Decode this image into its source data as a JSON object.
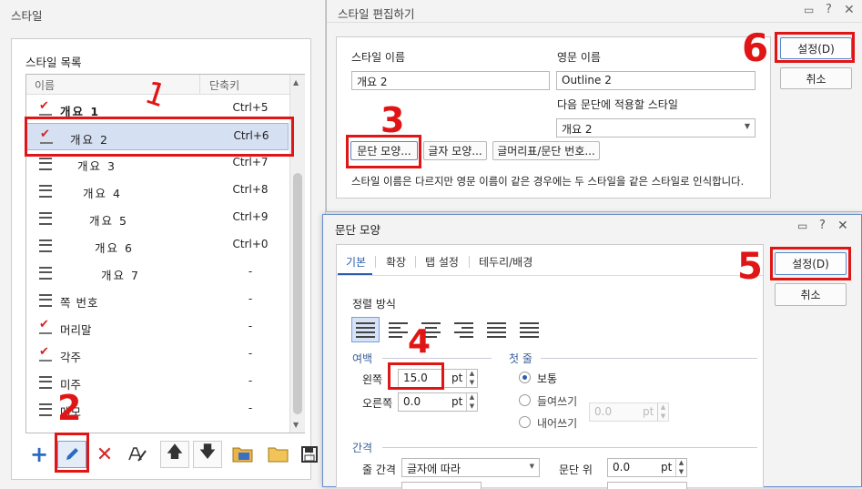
{
  "style_panel": {
    "title": "스타일",
    "list_label": "스타일 목록",
    "col_name": "이름",
    "col_shortcut": "단축키",
    "items": [
      {
        "name": "개요 1",
        "shortcut": "Ctrl+5",
        "icon": "checked-style-icon"
      },
      {
        "name": "개요 2",
        "shortcut": "Ctrl+6",
        "icon": "checked-style-icon"
      },
      {
        "name": "개요 3",
        "shortcut": "Ctrl+7",
        "icon": "paragraph-style-icon"
      },
      {
        "name": "개요 4",
        "shortcut": "Ctrl+8",
        "icon": "paragraph-style-icon"
      },
      {
        "name": "개요 5",
        "shortcut": "Ctrl+9",
        "icon": "paragraph-style-icon"
      },
      {
        "name": "개요 6",
        "shortcut": "Ctrl+0",
        "icon": "paragraph-style-icon"
      },
      {
        "name": "개요 7",
        "shortcut": "-",
        "icon": "paragraph-style-icon"
      },
      {
        "name": "쪽 번호",
        "shortcut": "-",
        "icon": "paragraph-style-icon"
      },
      {
        "name": "머리말",
        "shortcut": "-",
        "icon": "checked-style-icon"
      },
      {
        "name": "각주",
        "shortcut": "-",
        "icon": "checked-style-icon"
      },
      {
        "name": "미주",
        "shortcut": "-",
        "icon": "paragraph-style-icon"
      },
      {
        "name": "메모",
        "shortcut": "-",
        "icon": "paragraph-style-icon"
      }
    ],
    "toolbar": [
      "add-icon",
      "edit-pencil-icon",
      "delete-x-icon",
      "edit-style-icon",
      "move-up-icon",
      "move-down-icon",
      "import-style-icon",
      "open-folder-icon",
      "save-icon"
    ]
  },
  "edit_dialog": {
    "title": "스타일 편집하기",
    "name_label": "스타일 이름",
    "name_value": "개요 2",
    "eng_label": "영문 이름",
    "eng_value": "Outline 2",
    "next_label": "다음 문단에 적용할 스타일",
    "next_value": "개요 2",
    "btn_para": "문단 모양...",
    "btn_char": "글자 모양...",
    "btn_bullet": "글머리표/문단 번호...",
    "note": "스타일 이름은 다르지만 영문 이름이 같은 경우에는 두 스타일을 같은 스타일로 인식합니다.",
    "ok": "설정(D)",
    "cancel": "취소"
  },
  "para_dialog": {
    "title": "문단 모양",
    "tabs": [
      "기본",
      "확장",
      "탭 설정",
      "테두리/배경"
    ],
    "align_label": "정렬 방식",
    "margin_label": "여백",
    "left_label": "왼쪽",
    "left_value": "15.0",
    "right_label": "오른쪽",
    "right_value": "0.0",
    "unit": "pt",
    "first_line_label": "첫 줄",
    "radio_normal": "보통",
    "radio_indent": "들여쓰기",
    "radio_outdent": "내어쓰기",
    "indent_value": "0.0",
    "spacing_label": "간격",
    "line_spacing_label": "줄 간격",
    "line_spacing_value": "글자에 따라",
    "para_above_label": "문단 위",
    "para_above_value": "0.0",
    "ok": "설정(D)",
    "cancel": "취소"
  },
  "annotations": [
    "1",
    "2",
    "3",
    "4",
    "5",
    "6"
  ]
}
